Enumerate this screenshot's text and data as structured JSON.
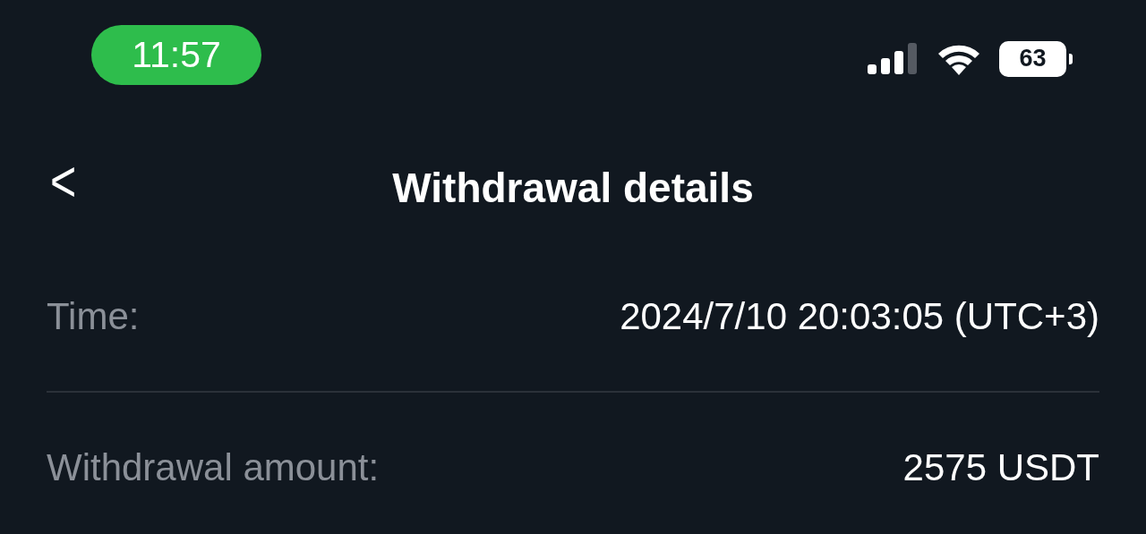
{
  "status_bar": {
    "time": "11:57",
    "battery": "63"
  },
  "header": {
    "back": "<",
    "title": "Withdrawal details"
  },
  "details": [
    {
      "label": "Time:",
      "value": "2024/7/10 20:03:05 (UTC+3)"
    },
    {
      "label": "Withdrawal amount:",
      "value": "2575 USDT"
    }
  ]
}
